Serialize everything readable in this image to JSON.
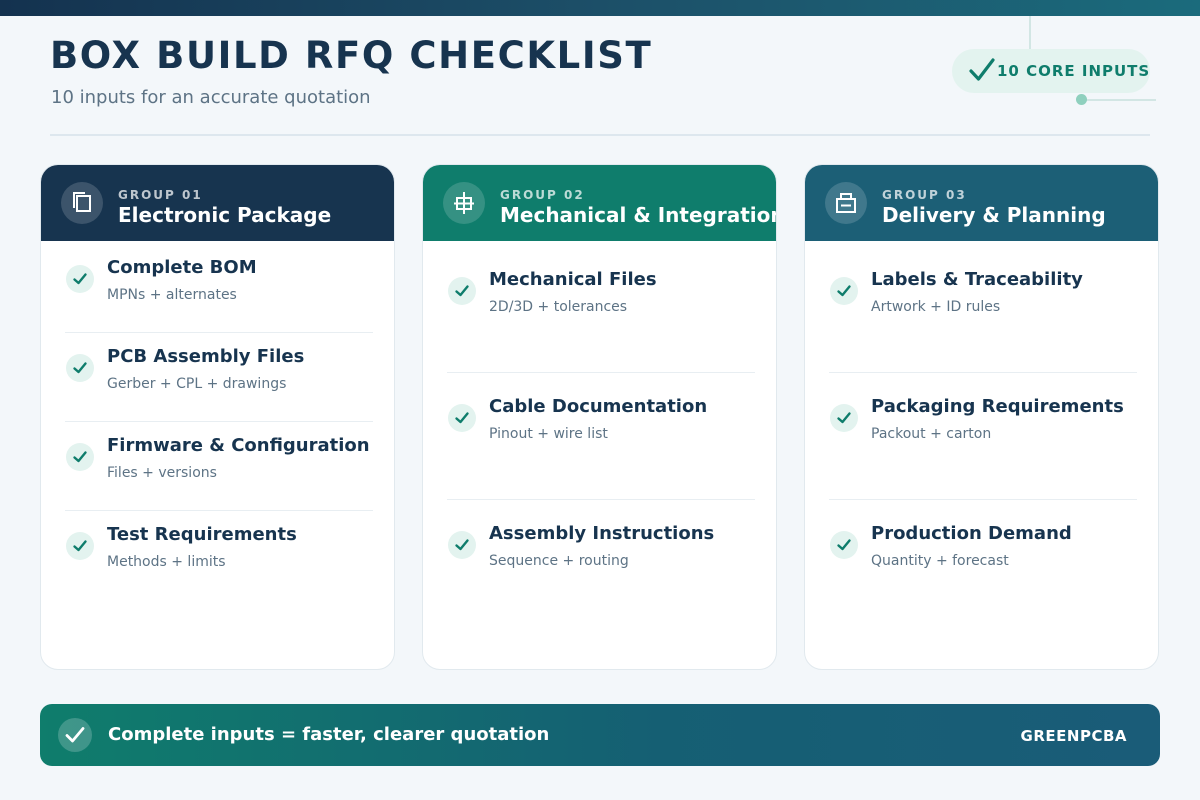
{
  "header": {
    "title": "BOX BUILD RFQ CHECKLIST",
    "subtitle": "10 inputs for an accurate quotation",
    "badge": "10 CORE INPUTS"
  },
  "colors": {
    "navy": "#17344f",
    "green": "#0f7d6c",
    "teal": "#1c5f76",
    "check_bg": "#e3f3ef",
    "page_bg": "#f3f7fa"
  },
  "groups": [
    {
      "number": "GROUP 01",
      "title": "Electronic Package",
      "icon": "copy-layers-icon",
      "items": [
        {
          "title": "Complete BOM",
          "desc": "MPNs + alternates"
        },
        {
          "title": "PCB Assembly Files",
          "desc": "Gerber + CPL + drawings"
        },
        {
          "title": "Firmware & Configuration",
          "desc": "Files + versions"
        },
        {
          "title": "Test Requirements",
          "desc": "Methods + limits"
        }
      ]
    },
    {
      "number": "GROUP 02",
      "title": "Mechanical & Integration",
      "icon": "mechanical-part-icon",
      "items": [
        {
          "title": "Mechanical Files",
          "desc": "2D/3D + tolerances"
        },
        {
          "title": "Cable Documentation",
          "desc": "Pinout + wire list"
        },
        {
          "title": "Assembly Instructions",
          "desc": "Sequence + routing"
        }
      ]
    },
    {
      "number": "GROUP 03",
      "title": "Delivery & Planning",
      "icon": "package-box-icon",
      "items": [
        {
          "title": "Labels & Traceability",
          "desc": "Artwork + ID rules"
        },
        {
          "title": "Packaging Requirements",
          "desc": "Packout + carton"
        },
        {
          "title": "Production Demand",
          "desc": "Quantity + forecast"
        }
      ]
    }
  ],
  "footer": {
    "message": "Complete inputs = faster, clearer quotation",
    "brand": "GREENPCBA"
  }
}
